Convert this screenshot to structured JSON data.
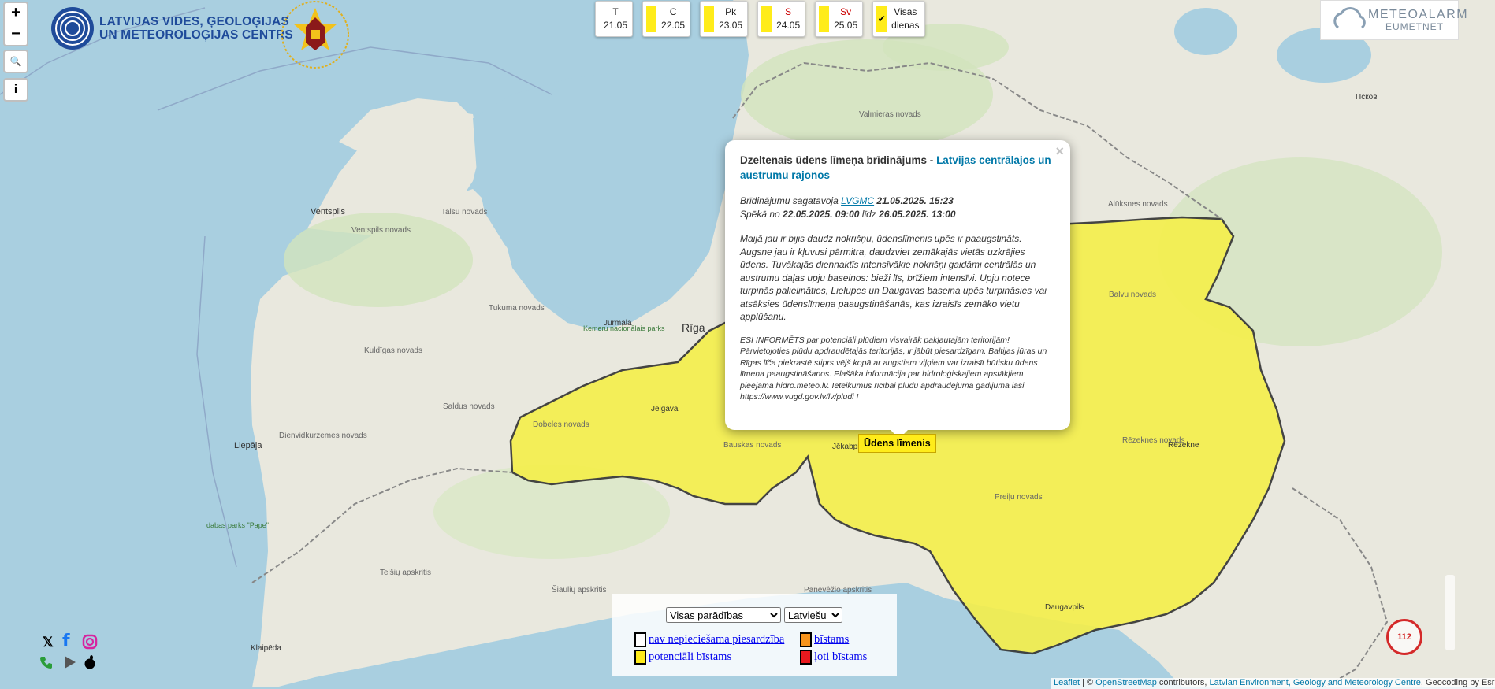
{
  "map": {
    "colors": {
      "water": "#a9cfe0",
      "land": "#eae8df",
      "forest": "#cfe3b9",
      "warning": "#ffec1a",
      "border": "#333333"
    },
    "places": [
      {
        "name": "Ventspils"
      },
      {
        "name": "Ventspils novads"
      },
      {
        "name": "Talsu novads"
      },
      {
        "name": "Tukuma novads"
      },
      {
        "name": "Kuldīgas novads"
      },
      {
        "name": "Saldus novads"
      },
      {
        "name": "Dienvidkurzemes novads"
      },
      {
        "name": "Liepāja"
      },
      {
        "name": "Jūrmala"
      },
      {
        "name": "Rīga"
      },
      {
        "name": "Jelgava"
      },
      {
        "name": "Dobeles novads"
      },
      {
        "name": "Bauskas novads"
      },
      {
        "name": "Jēkabpils"
      },
      {
        "name": "Rēzekne"
      },
      {
        "name": "Rēzeknes novads"
      },
      {
        "name": "Preiļu novads"
      },
      {
        "name": "Daugavpils"
      },
      {
        "name": "Balvu novads"
      },
      {
        "name": "Valmieras novads"
      },
      {
        "name": "Alūksnes novads"
      },
      {
        "name": "Klaipēda"
      },
      {
        "name": "Panevėžio apskritis"
      },
      {
        "name": "Šiaulių apskritis"
      },
      {
        "name": "Telšių apskritis"
      },
      {
        "name": "Псков"
      },
      {
        "name": "Kemeru nacionālais parks"
      },
      {
        "name": "dabas parks \"Pape\""
      }
    ]
  },
  "zoom": {
    "in": "+",
    "out": "−"
  },
  "tools": {
    "search": "🔍",
    "info": "i"
  },
  "logo": {
    "line1": "LATVIJAS VIDES, ĢEOLOĢIJAS",
    "line2": "UN METEOROLOĢIJAS CENTRS"
  },
  "days": [
    {
      "day": "T",
      "date": "21.05",
      "swatch": false,
      "red": false
    },
    {
      "day": "C",
      "date": "22.05",
      "swatch": true,
      "red": false
    },
    {
      "day": "Pk",
      "date": "23.05",
      "swatch": true,
      "red": false
    },
    {
      "day": "S",
      "date": "24.05",
      "swatch": true,
      "red": true
    },
    {
      "day": "Sv",
      "date": "25.05",
      "swatch": true,
      "red": true
    }
  ],
  "all_days": {
    "line1": "Visas",
    "line2": "dienas",
    "check": "✔"
  },
  "meteoalarm": {
    "title": "METEOALARM",
    "subtitle": "EUMETNET"
  },
  "popup": {
    "close": "×",
    "title_prefix": "Dzeltenais ūdens līmeņa brīdinājums - ",
    "title_link": "Latvijas centrālajos un austrumu rajonos",
    "prepared_prefix": "Brīdinājumu sagatavoja ",
    "prepared_link": "LVGMC",
    "prepared_date": " 21.05.2025. 15:23",
    "valid_prefix": "Spēkā no ",
    "valid_from": "22.05.2025. 09:00",
    "valid_mid": " līdz ",
    "valid_to": "26.05.2025. 13:00",
    "text": "Maijā jau ir bijis daudz nokrišņu, ūdenslīmenis upēs ir paaugstināts. Augsne jau ir kļuvusi pārmitra, daudzviet zemākajās vietās uzkrājies ūdens. Tuvākajās diennaktīs intensīvākie nokrišņi gaidāmi centrālās un austrumu daļas upju baseinos: bieži līs, brīžiem intensīvi. Upju notece turpinās palielināties, Lielupes un Daugavas baseina upēs turpināsies vai atsāksies ūdenslīmeņa paaugstināšanās, kas izraisīs zemāko vietu applūšanu.",
    "small": "ESI INFORMĒTS par potenciāli plūdiem visvairāk pakļautajām teritorijām! Pārvietojoties plūdu apdraudētajās teritorijās, ir jābūt piesardzīgam. Baltijas jūras un Rīgas līča piekrastē stiprs vējš kopā ar augstiem viļņiem var izraisīt būtisku ūdens līmeņa paaugstināšanos. Plašāka informācija par hidroloģiskajiem apstākļiem pieejama hidro.meteo.lv. Ieteikumus rīcībai plūdu apdraudējuma gadījumā lasi https://www.vugd.gov.lv/lv/pludi !"
  },
  "tooltip": "Ūdens līmenis",
  "legend": {
    "filter": "Visas parādības",
    "language": "Latviešu",
    "items": [
      {
        "label": "nav nepieciešama piesardzība",
        "color": "#ffffff"
      },
      {
        "label": "bīstams",
        "color": "#f7941d"
      },
      {
        "label": "potenciāli bīstams",
        "color": "#ffec1a"
      },
      {
        "label": "ļoti bīstams",
        "color": "#e8191e"
      }
    ]
  },
  "attribution": {
    "leaflet": "Leaflet",
    "sep": " | © ",
    "osm": "OpenStreetMap",
    "contrib": " contributors, ",
    "lvgmc": "Latvian Environment, Geology and Meteorology Centre",
    "geo": ", Geocoding by Esri"
  },
  "emergency": "112",
  "social": {
    "x": "𝕏",
    "fb": "f"
  }
}
